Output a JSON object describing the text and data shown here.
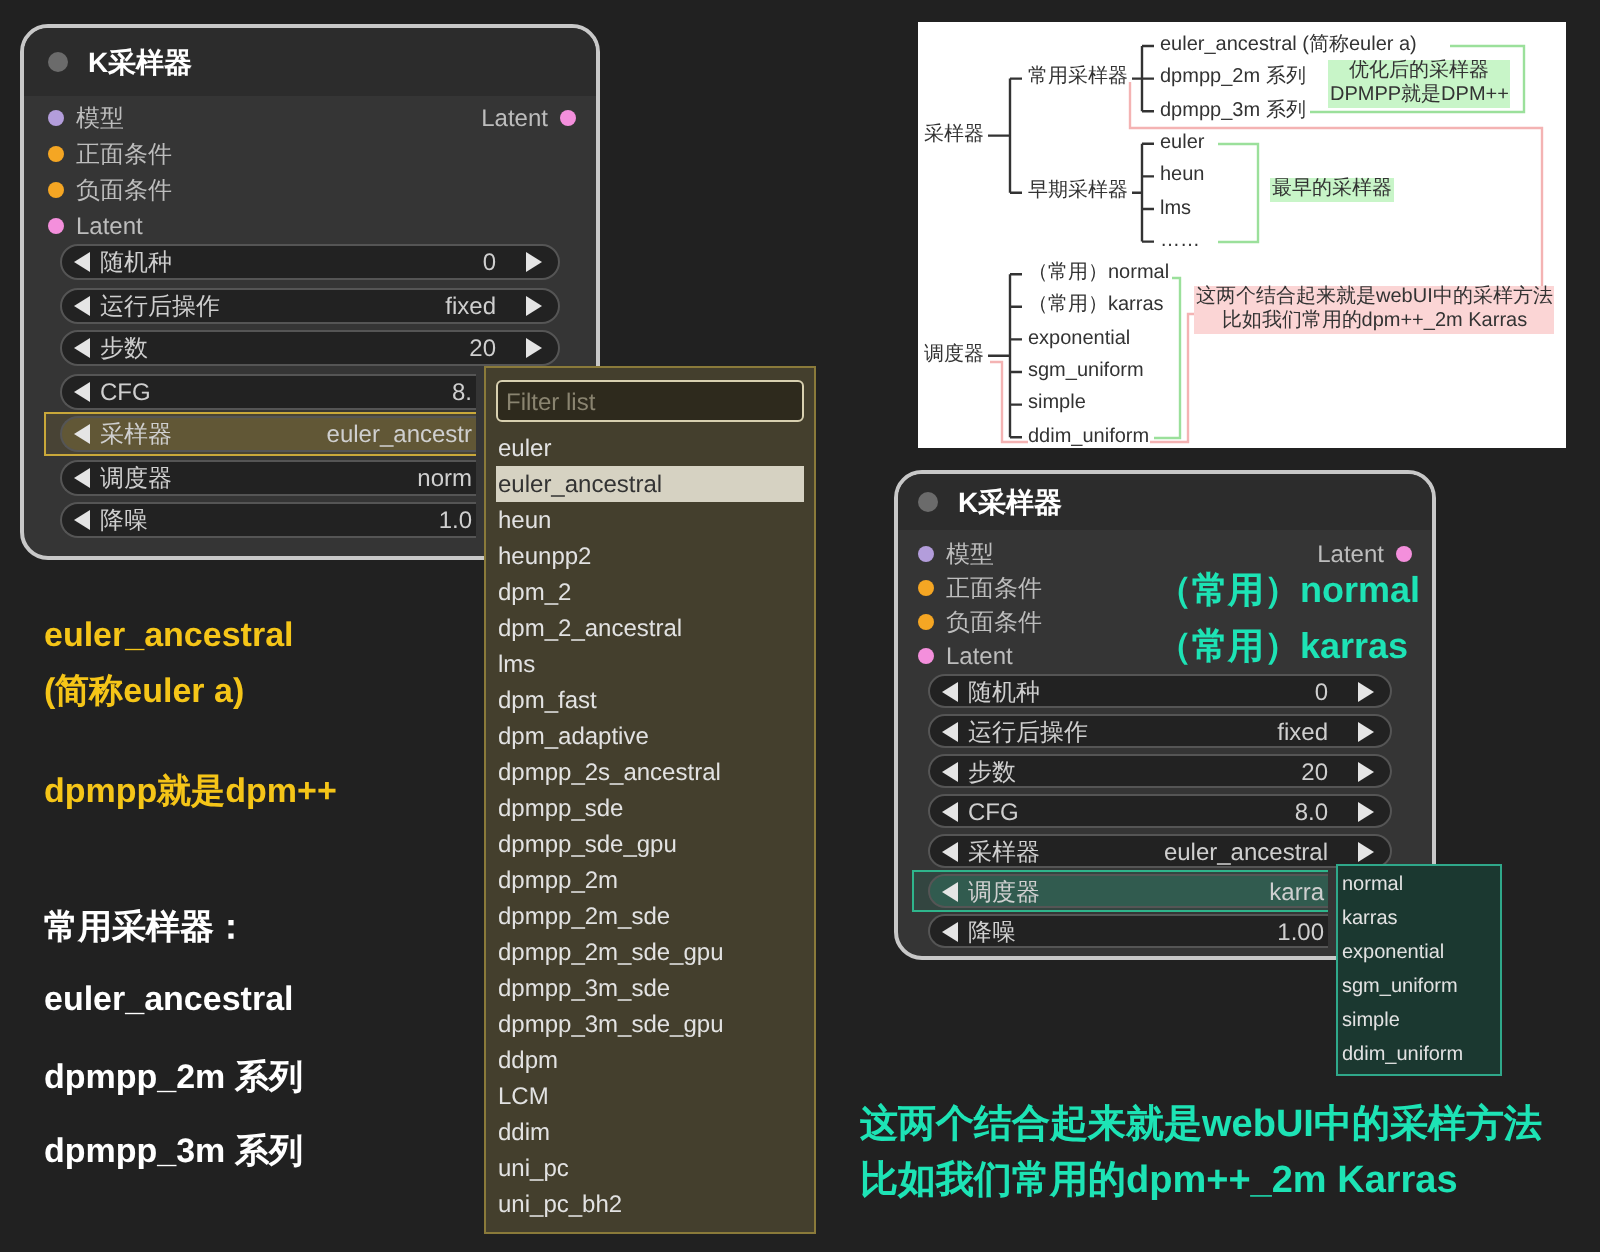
{
  "nodes": [
    {
      "title": "K采样器",
      "color": "#c9a83a",
      "inputs": [
        {
          "label": "模型",
          "color": "#b39ddb"
        },
        {
          "label": "正面条件",
          "color": "#f5a623"
        },
        {
          "label": "负面条件",
          "color": "#f5a623"
        },
        {
          "label": "Latent",
          "color": "#f48fdc"
        }
      ],
      "output": {
        "label": "Latent",
        "color": "#f48fdc"
      },
      "widgets": [
        {
          "label": "随机种",
          "value": "0",
          "selected": false,
          "covered": false
        },
        {
          "label": "运行后操作",
          "value": "fixed",
          "selected": false,
          "covered": false
        },
        {
          "label": "步数",
          "value": "20",
          "selected": false,
          "covered": false
        },
        {
          "label": "CFG",
          "value": "8.",
          "selected": false,
          "covered": true
        },
        {
          "label": "采样器",
          "value": "euler_ancestr",
          "selected": true,
          "covered": true
        },
        {
          "label": "调度器",
          "value": "norm",
          "selected": false,
          "covered": true
        },
        {
          "label": "降噪",
          "value": "1.0",
          "selected": false,
          "covered": true
        }
      ]
    },
    {
      "title": "K采样器",
      "color": "#2fb58c",
      "inputs": [
        {
          "label": "模型",
          "color": "#b39ddb"
        },
        {
          "label": "正面条件",
          "color": "#f5a623"
        },
        {
          "label": "负面条件",
          "color": "#f5a623"
        },
        {
          "label": "Latent",
          "color": "#f48fdc"
        }
      ],
      "output": {
        "label": "Latent",
        "color": "#f48fdc"
      },
      "widgets": [
        {
          "label": "随机种",
          "value": "0",
          "selected": false,
          "covered": false
        },
        {
          "label": "运行后操作",
          "value": "fixed",
          "selected": false,
          "covered": false
        },
        {
          "label": "步数",
          "value": "20",
          "selected": false,
          "covered": false
        },
        {
          "label": "CFG",
          "value": "8.0",
          "selected": false,
          "covered": false
        },
        {
          "label": "采样器",
          "value": "euler_ancestral",
          "selected": false,
          "covered": false
        },
        {
          "label": "调度器",
          "value": "karra",
          "selected": true,
          "covered": true
        },
        {
          "label": "降噪",
          "value": "1.00",
          "selected": false,
          "covered": true
        }
      ]
    }
  ],
  "sampler_menu": {
    "placeholder": "Filter list",
    "options": [
      {
        "label": "euler",
        "selected": false
      },
      {
        "label": "euler_ancestral",
        "selected": true
      },
      {
        "label": "heun",
        "selected": false
      },
      {
        "label": "heunpp2",
        "selected": false
      },
      {
        "label": "dpm_2",
        "selected": false
      },
      {
        "label": "dpm_2_ancestral",
        "selected": false
      },
      {
        "label": "lms",
        "selected": false
      },
      {
        "label": "dpm_fast",
        "selected": false
      },
      {
        "label": "dpm_adaptive",
        "selected": false
      },
      {
        "label": "dpmpp_2s_ancestral",
        "selected": false
      },
      {
        "label": "dpmpp_sde",
        "selected": false
      },
      {
        "label": "dpmpp_sde_gpu",
        "selected": false
      },
      {
        "label": "dpmpp_2m",
        "selected": false
      },
      {
        "label": "dpmpp_2m_sde",
        "selected": false
      },
      {
        "label": "dpmpp_2m_sde_gpu",
        "selected": false
      },
      {
        "label": "dpmpp_3m_sde",
        "selected": false
      },
      {
        "label": "dpmpp_3m_sde_gpu",
        "selected": false
      },
      {
        "label": "ddpm",
        "selected": false
      },
      {
        "label": "LCM",
        "selected": false
      },
      {
        "label": "ddim",
        "selected": false
      },
      {
        "label": "uni_pc",
        "selected": false
      },
      {
        "label": "uni_pc_bh2",
        "selected": false
      }
    ]
  },
  "scheduler_menu": {
    "options": [
      {
        "label": "normal",
        "selected": false
      },
      {
        "label": "karras",
        "selected": false
      },
      {
        "label": "exponential",
        "selected": false
      },
      {
        "label": "sgm_uniform",
        "selected": false
      },
      {
        "label": "simple",
        "selected": false
      },
      {
        "label": "ddim_uniform",
        "selected": false
      }
    ]
  },
  "mind_map": {
    "nodes": [
      {
        "label": "采样器",
        "children": [
          {
            "label": "常用采样器",
            "children": [
              {
                "label": "euler_ancestral (简称euler a)"
              },
              {
                "label": "dpmpp_2m 系列"
              },
              {
                "label": "dpmpp_3m 系列"
              }
            ]
          },
          {
            "label": "早期采样器",
            "children": [
              {
                "label": "euler"
              },
              {
                "label": "heun"
              },
              {
                "label": "lms"
              },
              {
                "label": "……"
              }
            ]
          }
        ]
      },
      {
        "label": "调度器",
        "children": [
          {
            "label": "（常用）normal"
          },
          {
            "label": "（常用）karras"
          },
          {
            "label": "exponential"
          },
          {
            "label": "sgm_uniform"
          },
          {
            "label": "simple"
          },
          {
            "label": "ddim_uniform"
          }
        ]
      }
    ],
    "notes": [
      {
        "lines": [
          "优化后的采样器",
          "DPMPP就是DPM++"
        ],
        "color": "#c8f5c8"
      },
      {
        "lines": [
          "最早的采样器"
        ],
        "color": "#c8f5c8"
      },
      {
        "lines": [
          "这两个结合起来就是webUI中的采样方法",
          "比如我们常用的dpm++_2m Karras"
        ],
        "color": "#fbd5d5"
      }
    ]
  },
  "left_notes": [
    {
      "text": "euler_ancestral",
      "kind": "highlight"
    },
    {
      "text": "(简称euler a)",
      "kind": "highlight"
    },
    {
      "text": "dpmpp就是dpm++",
      "kind": "highlight"
    },
    {
      "text": "常用采样器：",
      "kind": "plain"
    },
    {
      "text": "euler_ancestral",
      "kind": "plain"
    },
    {
      "text": "dpmpp_2m 系列",
      "kind": "plain"
    },
    {
      "text": "dpmpp_3m 系列",
      "kind": "plain"
    }
  ],
  "scheduler_notes": [
    "（常用）normal",
    "（常用）karras"
  ],
  "bottom_note": [
    "这两个结合起来就是webUI中的采样方法",
    "比如我们常用的dpm++_2m Karras"
  ]
}
